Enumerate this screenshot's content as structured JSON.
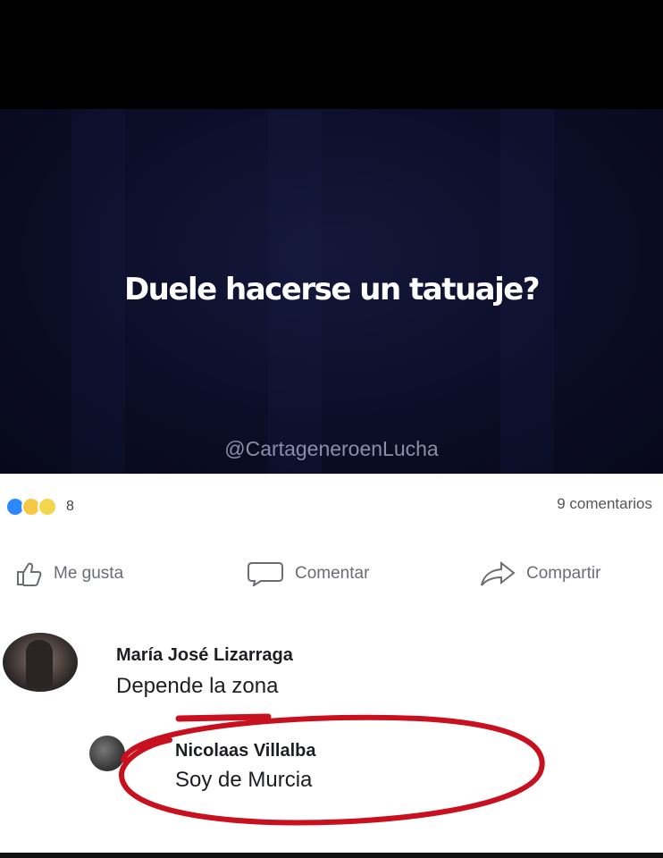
{
  "post": {
    "question": "Duele hacerse un tatuaje?",
    "watermark": "@CartageneroenLucha"
  },
  "stats": {
    "reaction_count": "8",
    "reaction_icons": [
      "like-reaction-icon",
      "haha-reaction-icon",
      "sad-reaction-icon"
    ],
    "comments": "9 comentarios"
  },
  "actions": {
    "like": "Me gusta",
    "comment": "Comentar",
    "share": "Compartir"
  },
  "comments": [
    {
      "name": "María José Lizarraga",
      "text": "Depende la zona"
    },
    {
      "name": "Nicolaas Villalba",
      "text": "Soy de Murcia"
    }
  ],
  "colors": {
    "accent_blue": "#2d88ff",
    "highlight_red": "#c8101e",
    "post_background": "#0c0e28"
  }
}
